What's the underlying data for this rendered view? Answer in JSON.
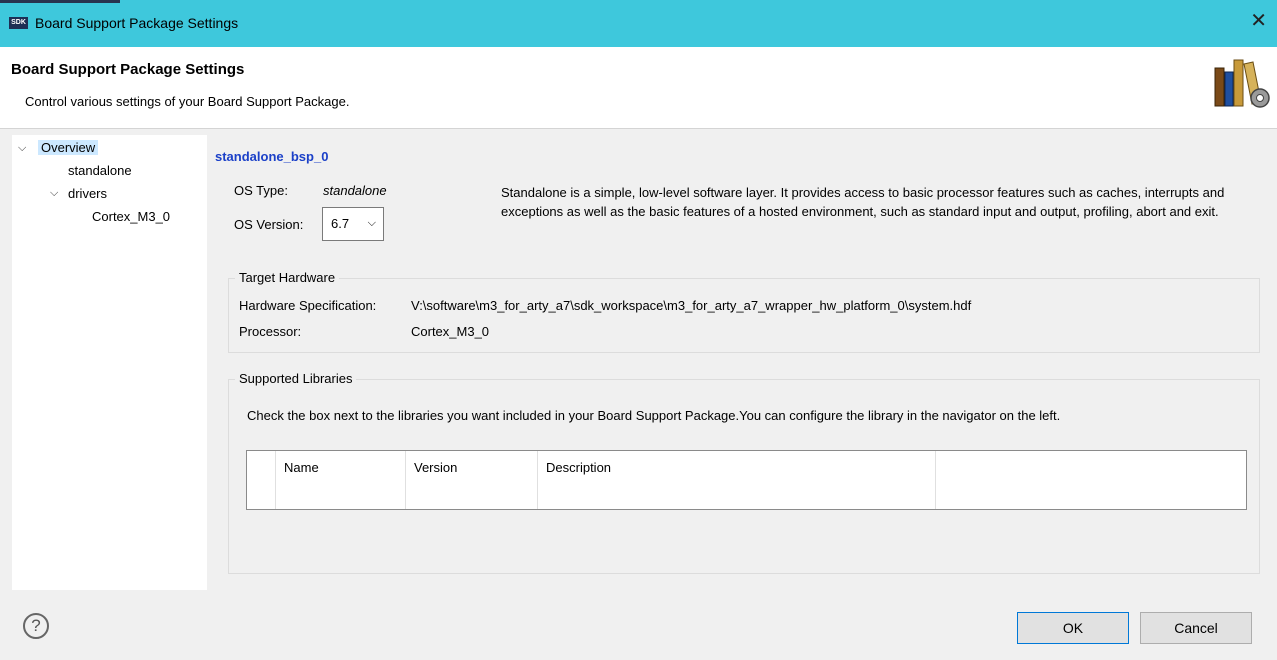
{
  "window": {
    "title": "Board Support Package Settings",
    "app_icon_text": "SDK",
    "close_glyph": "✕"
  },
  "header": {
    "title": "Board Support Package Settings",
    "description": "Control various settings of your Board Support Package."
  },
  "nav": {
    "items": [
      {
        "label": "Overview"
      },
      {
        "label": "standalone"
      },
      {
        "label": "drivers"
      },
      {
        "label": "Cortex_M3_0"
      }
    ]
  },
  "overview": {
    "bsp_name": "standalone_bsp_0",
    "os_type_label": "OS Type:",
    "os_type_value": "standalone",
    "os_version_label": "OS Version:",
    "os_version_value": "6.7",
    "os_description": "Standalone is a simple, low-level software layer. It provides access to basic processor features such as caches, interrupts and exceptions as well as the basic features of a hosted environment, such as standard input and output, profiling, abort and exit."
  },
  "target_hardware": {
    "title": "Target Hardware",
    "hw_spec_label": "Hardware Specification:",
    "hw_spec_value": "V:\\software\\m3_for_arty_a7\\sdk_workspace\\m3_for_arty_a7_wrapper_hw_platform_0\\system.hdf",
    "processor_label": "Processor:",
    "processor_value": "Cortex_M3_0"
  },
  "supported_libraries": {
    "title": "Supported Libraries",
    "description": "Check the box next to the libraries you want included in your Board Support Package.You can configure the library in the navigator on the left.",
    "columns": [
      "Name",
      "Version",
      "Description"
    ]
  },
  "footer": {
    "help_glyph": "?",
    "ok_label": "OK",
    "cancel_label": "Cancel"
  }
}
